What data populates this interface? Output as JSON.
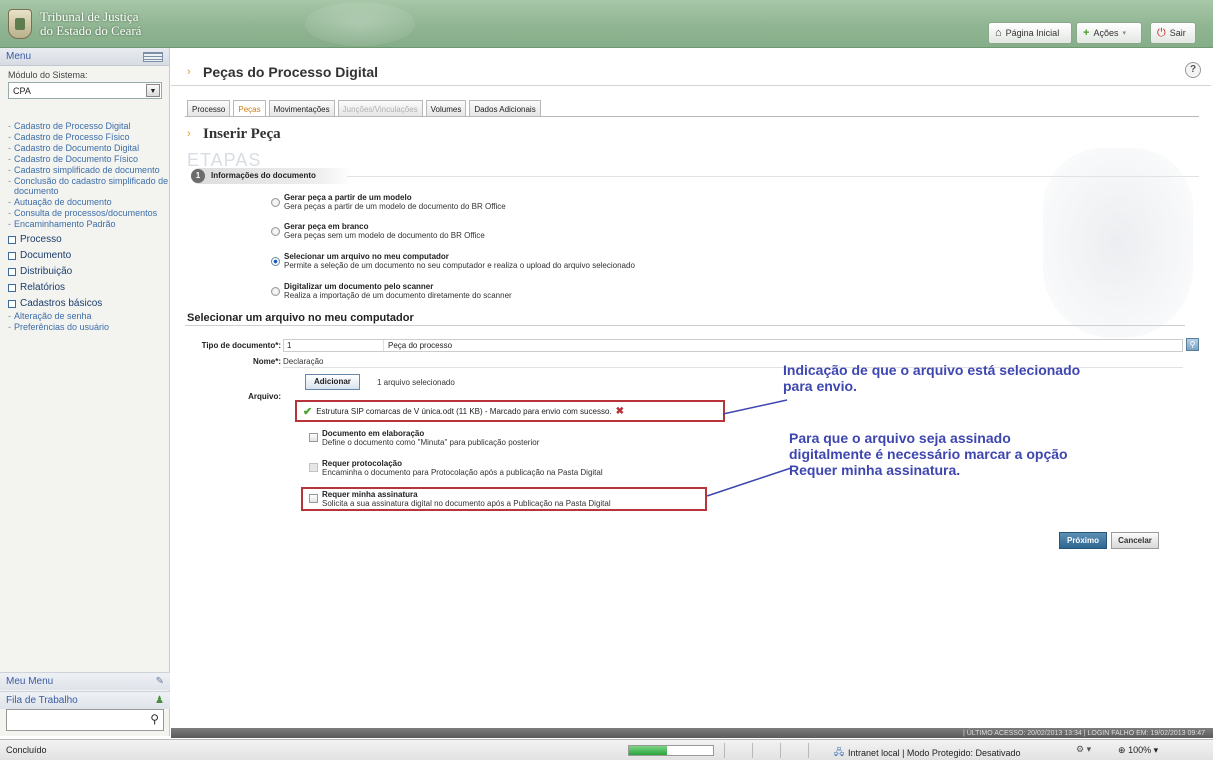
{
  "header": {
    "logo_line1": "Tribunal de Justiça",
    "logo_line2": "do Estado do Ceará",
    "home_label": "Página Inicial",
    "actions_label": "Ações",
    "exit_label": "Sair"
  },
  "sidebar": {
    "menu_label": "Menu",
    "module_label": "Módulo do Sistema:",
    "module_value": "CPA",
    "links": [
      "Cadastro de Processo Digital",
      "Cadastro de Processo Físico",
      "Cadastro de Documento Digital",
      "Cadastro de Documento Físico",
      "Cadastro simplificado de documento",
      "Conclusão do cadastro simplificado de documento",
      "Autuação de documento",
      "Consulta de processos/documentos",
      "Encaminhamento Padrão"
    ],
    "sections": [
      "Processo",
      "Documento",
      "Distribuição",
      "Relatórios",
      "Cadastros básicos"
    ],
    "sub_links": [
      "Alteração de senha",
      "Preferências do usuário"
    ],
    "meu_menu": "Meu Menu",
    "fila": "Fila de Trabalho"
  },
  "main": {
    "page_title": "Peças do Processo Digital",
    "help": "?",
    "tabs": [
      "Processo",
      "Peças",
      "Movimentações",
      "Junções/Vinculações",
      "Volumes",
      "Dados Adicionais"
    ],
    "sub_title": "Inserir Peça",
    "etapas": "ETAPAS",
    "step_num": "1",
    "step_label": "Informações do documento",
    "options": [
      {
        "title": "Gerar peça a partir de um modelo",
        "desc": "Gera peças a partir de um modelo de documento do BR Office"
      },
      {
        "title": "Gerar peça em branco",
        "desc": "Gera peças sem um modelo de documento do BR Office"
      },
      {
        "title": "Selecionar um arquivo no meu computador",
        "desc": "Permite a seleção de um documento no seu computador e realiza o upload do arquivo selecionado"
      },
      {
        "title": "Digitalizar um documento pelo scanner",
        "desc": "Realiza a importação de um documento diretamente do scanner"
      }
    ],
    "section_title": "Selecionar um arquivo no meu computador",
    "tipo_label": "Tipo de documento*:",
    "tipo_code": "1",
    "tipo_value": "Peça do processo",
    "nome_label": "Nome*:",
    "nome_value": "Declaração",
    "add_button": "Adicionar",
    "add_status": "1 arquivo selecionado",
    "arquivo_label": "Arquivo:",
    "file_text": "Estrutura SIP comarcas de V única.odt (11 KB) - Marcado para envio com sucesso.",
    "checkboxes": [
      {
        "title": "Documento em elaboração",
        "desc": "Define o documento como \"Minuta\" para publicação posterior"
      },
      {
        "title": "Requer protocolação",
        "desc": "Encaminha o documento para Protocolação após a publicação na Pasta Digital"
      },
      {
        "title": "Requer minha assinatura",
        "desc": "Solicita a sua assinatura digital no documento após a Publicação na Pasta Digital"
      }
    ],
    "annotation1_l1": "Indicação de que o arquivo está selecionado",
    "annotation1_l2": "para envio.",
    "annotation2_l1": "Para que o arquivo seja assinado",
    "annotation2_l2": "digitalmente é necessário marcar a opção",
    "annotation2_l3": "Requer minha assinatura.",
    "next_button": "Próximo",
    "cancel_button": "Cancelar",
    "footer_info": "| ÚLTIMO ACESSO: 20/02/2013 13:34 | LOGIN FALHO EM: 19/02/2013 09:47"
  },
  "statusbar": {
    "text": "Concluído",
    "progress": 0.45,
    "zone": "Intranet local | Modo Protegido: Desativado",
    "zoom": "100%"
  }
}
